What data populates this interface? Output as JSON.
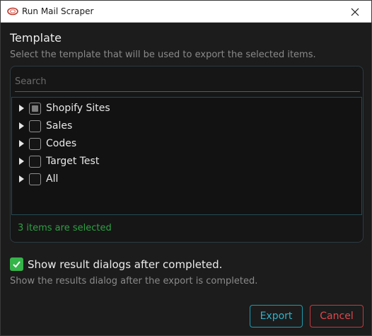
{
  "window": {
    "title": "Run Mail Scraper"
  },
  "heading": "Template",
  "subheading": "Select the template that will be used to export the selected items.",
  "search": {
    "placeholder": "Search",
    "value": ""
  },
  "tree": {
    "items": [
      {
        "label": "Shopify Sites",
        "state": "partial"
      },
      {
        "label": "Sales",
        "state": "unchecked"
      },
      {
        "label": "Codes",
        "state": "unchecked"
      },
      {
        "label": "Target Test",
        "state": "unchecked"
      },
      {
        "label": "All",
        "state": "unchecked"
      }
    ]
  },
  "selected_count": "3 items are selected",
  "option": {
    "checked": true,
    "label": "Show result dialogs after completed.",
    "description": "Show the results dialog after the export is completed."
  },
  "buttons": {
    "export": "Export",
    "cancel": "Cancel"
  },
  "colors": {
    "accent": "#1c9bb0",
    "danger": "#c33a3f",
    "success": "#2ea043",
    "check": "#35b44a"
  }
}
